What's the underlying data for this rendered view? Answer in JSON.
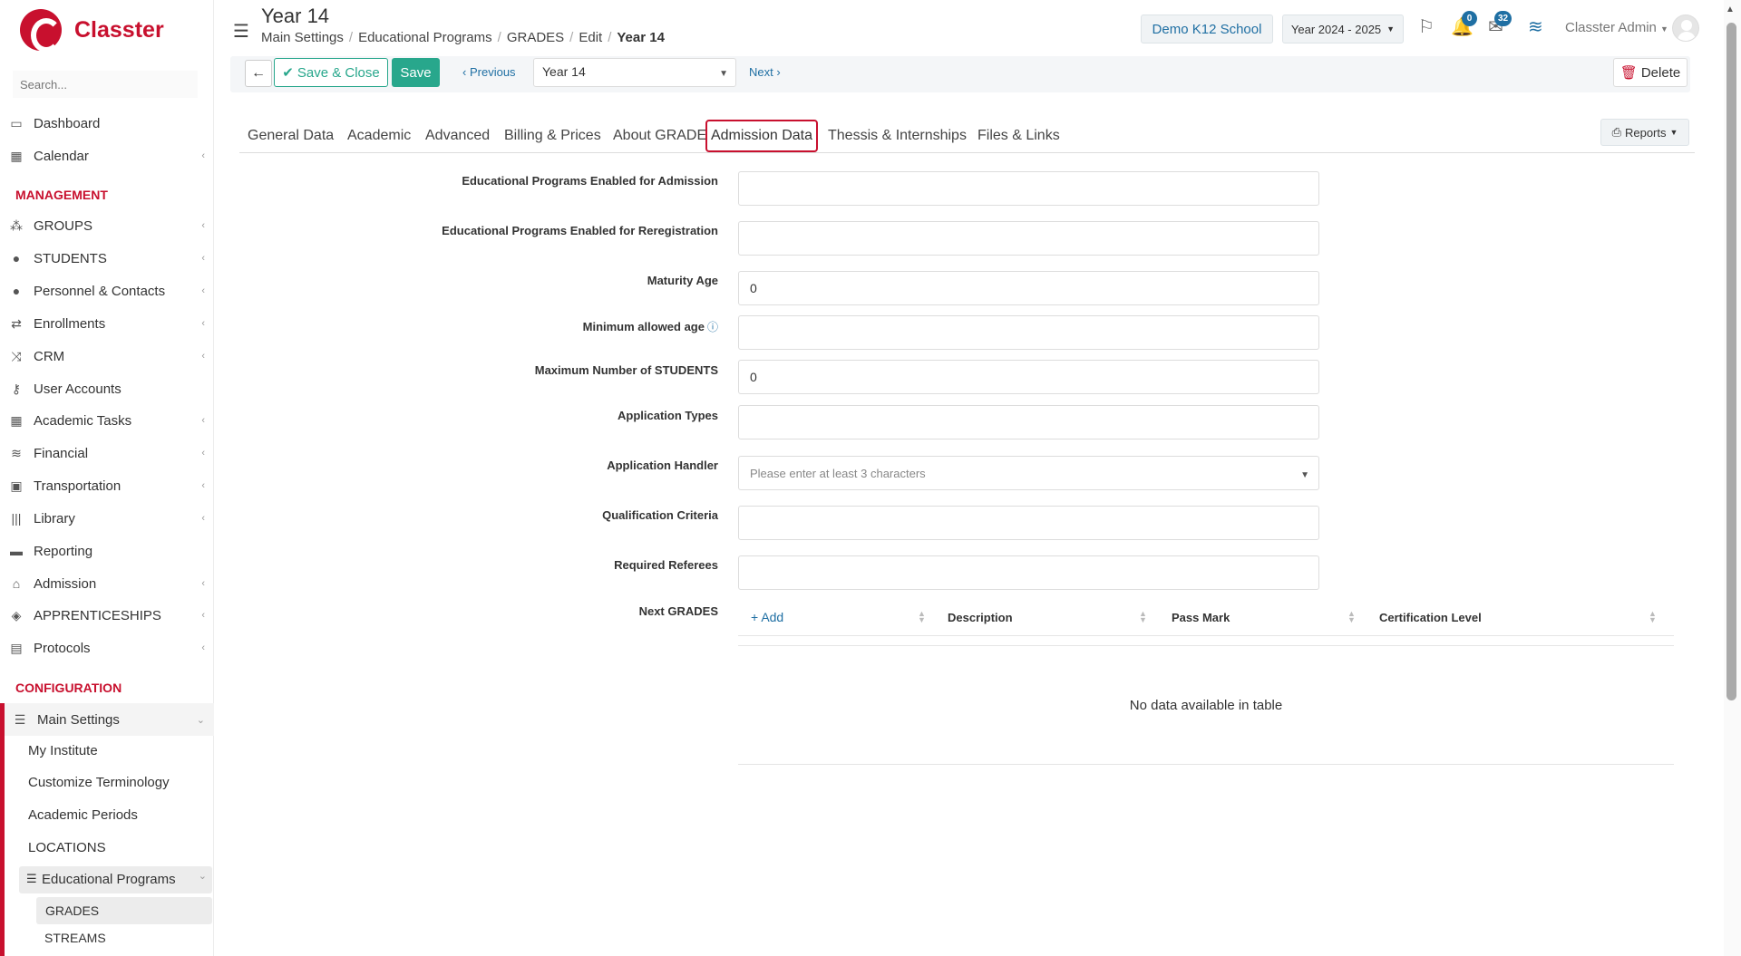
{
  "brand": {
    "name": "Classter"
  },
  "sidebar": {
    "search_placeholder": "Search...",
    "items": [
      {
        "label": "Dashboard",
        "icon": "laptop-icon"
      },
      {
        "label": "Calendar",
        "icon": "calendar-icon"
      }
    ],
    "management_title": "MANAGEMENT",
    "management": [
      {
        "label": "GROUPS",
        "icon": "groups-icon"
      },
      {
        "label": "STUDENTS",
        "icon": "students-icon"
      },
      {
        "label": "Personnel & Contacts",
        "icon": "person-icon"
      },
      {
        "label": "Enrollments",
        "icon": "exchange-icon"
      },
      {
        "label": "CRM",
        "icon": "crm-icon"
      },
      {
        "label": "User Accounts",
        "icon": "key-icon"
      },
      {
        "label": "Academic Tasks",
        "icon": "grid-icon"
      },
      {
        "label": "Financial",
        "icon": "coins-icon"
      },
      {
        "label": "Transportation",
        "icon": "bus-icon"
      },
      {
        "label": "Library",
        "icon": "library-icon"
      },
      {
        "label": "Reporting",
        "icon": "printer-icon"
      },
      {
        "label": "Admission",
        "icon": "institution-icon"
      },
      {
        "label": "APPRENTICESHIPS",
        "icon": "cube-icon"
      },
      {
        "label": "Protocols",
        "icon": "protocol-icon"
      }
    ],
    "configuration_title": "CONFIGURATION",
    "main_settings": "Main Settings",
    "sub_items": [
      "My Institute",
      "Customize Terminology",
      "Academic Periods",
      "LOCATIONS"
    ],
    "educational_programs": "Educational Programs",
    "grades": "GRADES",
    "streams": "STREAMS"
  },
  "header": {
    "title": "Year 14",
    "breadcrumb": [
      "Main Settings",
      "Educational Programs",
      "GRADES",
      "Edit",
      "Year 14"
    ],
    "school": "Demo K12 School",
    "year": "Year 2024 - 2025",
    "notifications_count": "0",
    "messages_count": "32",
    "user": "Classter Admin"
  },
  "toolbar": {
    "save_close": "Save & Close",
    "save": "Save",
    "previous": "Previous",
    "record": "Year 14",
    "next": "Next",
    "delete": "Delete"
  },
  "tabs": [
    "General Data",
    "Academic",
    "Advanced",
    "Billing & Prices",
    "About GRADE",
    "Admission Data",
    "Thessis & Internships",
    "Files & Links"
  ],
  "active_tab": "Admission Data",
  "reports": "Reports",
  "form": {
    "fields": [
      {
        "label": "Educational Programs Enabled for Admission",
        "value": ""
      },
      {
        "label": "Educational Programs Enabled for Reregistration",
        "value": ""
      },
      {
        "label": "Maturity Age",
        "value": "0"
      },
      {
        "label": "Minimum allowed age",
        "value": ""
      },
      {
        "label": "Maximum Number of STUDENTS",
        "value": "0"
      },
      {
        "label": "Application Types",
        "value": ""
      },
      {
        "label": "Application Handler",
        "placeholder": "Please enter at least 3 characters"
      },
      {
        "label": "Qualification Criteria",
        "value": ""
      },
      {
        "label": "Required Referees",
        "value": ""
      }
    ],
    "next_grades_label": "Next GRADES",
    "table": {
      "add": "Add",
      "columns": [
        "Description",
        "Pass Mark",
        "Certification Level"
      ],
      "empty": "No data available in table"
    }
  },
  "colors": {
    "brand_red": "#c8102e",
    "accent_blue": "#1f6fa3",
    "save_green": "#28a78c"
  }
}
